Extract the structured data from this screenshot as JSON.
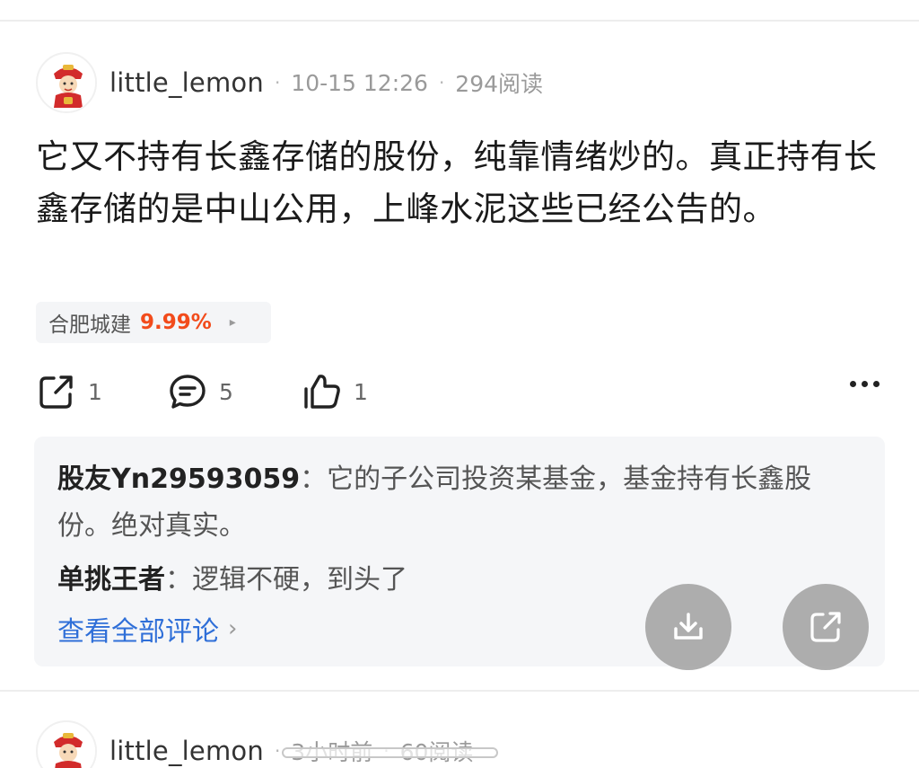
{
  "post": {
    "username": "little_lemon",
    "time": "10-15 12:26",
    "reads": "294阅读",
    "body": "它又不持有长鑫存储的股份，纯靠情绪炒的。真正持有长鑫存储的是中山公用，上峰水泥这些已经公告的。",
    "stock_tag": {
      "name": "合肥城建",
      "change": "9.99%",
      "arrow": "▸"
    },
    "actions": {
      "share_count": "1",
      "comment_count": "5",
      "like_count": "1"
    },
    "comments": [
      {
        "author": "股友Yn29593059",
        "sep": "：",
        "text": "它的子公司投资某基金，基金持有长鑫股份。绝对真实。"
      },
      {
        "author": "单挑王者",
        "sep": "：",
        "text": "逻辑不硬，到头了"
      }
    ],
    "view_all": "查看全部评论",
    "view_all_chev": "›"
  },
  "next_post": {
    "username": "little_lemon",
    "time": "3小时前",
    "reads": "60阅读"
  },
  "colors": {
    "accent_red": "#f24b1b",
    "link_blue": "#2f6fd8",
    "fab_gray": "#a0a0a0"
  },
  "icons": {
    "share": "share-icon",
    "comment": "comment-icon",
    "like": "thumbs-up-icon",
    "more": "more-icon",
    "download": "download-icon",
    "external": "external-share-icon"
  }
}
